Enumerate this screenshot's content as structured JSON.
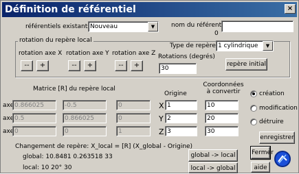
{
  "window": {
    "title": "Définition de référentiel",
    "close_glyph": "×"
  },
  "referentiels_label": "référentiels existants:",
  "referentiel_select": "Nouveau",
  "nom_label": "nom du référentiel:",
  "nom_value": "",
  "nom_index": "0",
  "rotation_group": {
    "title": "rotation du repère local",
    "axes": [
      {
        "label": "rotation axe X",
        "minus": "--",
        "plus": "+"
      },
      {
        "label": "rotation axe Y",
        "minus": "--",
        "plus": "+"
      },
      {
        "label": "rotation axe Z",
        "minus": "--",
        "plus": "+"
      }
    ],
    "type_label": "Type de repère:",
    "type_value": "1 cylindrique",
    "rotations_label": "Rotations (degrés)",
    "rotations_value": "30",
    "initial_button": "repère initial"
  },
  "matrix": {
    "title": "Matrice [R] du repère local",
    "rows": [
      {
        "label": "axe X",
        "values": [
          "0.866025",
          "-0.5",
          "0"
        ]
      },
      {
        "label": "axe Y",
        "values": [
          "0.5",
          "0.866025",
          "0"
        ]
      },
      {
        "label": "axe Z",
        "values": [
          "0",
          "0",
          "1"
        ]
      }
    ]
  },
  "origine": {
    "title": "Origine",
    "rows": [
      {
        "label": "X",
        "value": "1"
      },
      {
        "label": "Y",
        "value": "2"
      },
      {
        "label": "Z",
        "value": "3"
      }
    ]
  },
  "convertir": {
    "title": "Coordonnées à convertir",
    "values": [
      "10",
      "20",
      "30"
    ]
  },
  "mode": {
    "options": [
      "création",
      "modification",
      "détruire"
    ],
    "selected": 0
  },
  "formula": "Changement de repère: X_local = [R] (X_global - Origine)",
  "global_line": "global:  10.8481  0.263518  33",
  "local_line": "local:  10  20°  30",
  "buttons": {
    "enregistrer": "enregistrer",
    "fermer": "Fermer",
    "aide": "aide",
    "global_to_local": "global -> local",
    "local_to_global": "local -> global"
  }
}
